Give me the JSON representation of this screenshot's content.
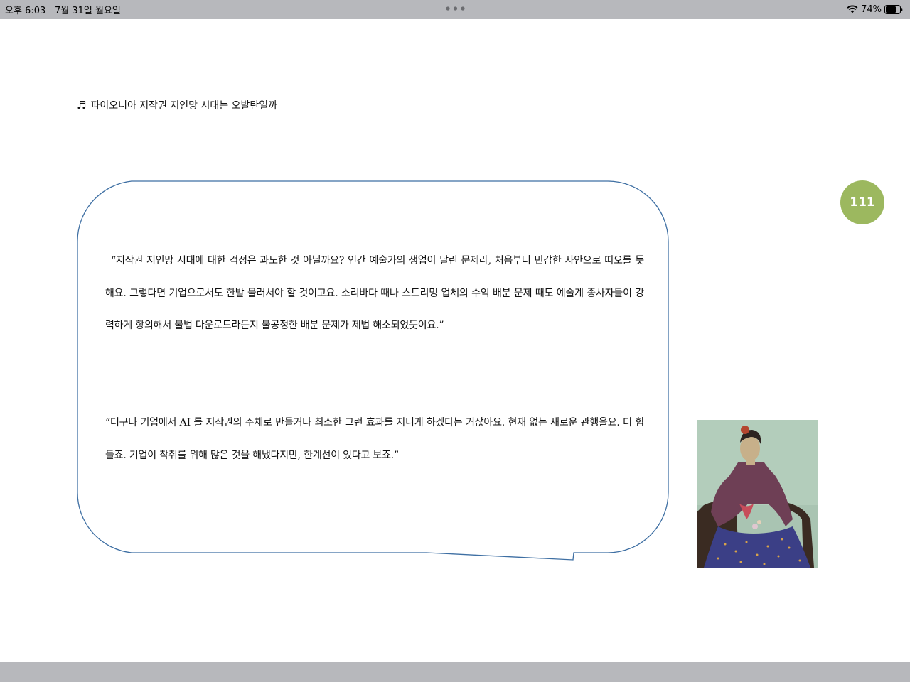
{
  "status_bar": {
    "time": "오후 6:03",
    "date": "7월 31일 월요일",
    "battery_percent": "74%",
    "battery_level": 0.74,
    "icons": [
      "wifi-icon",
      "battery-icon",
      "more-dots-icon"
    ]
  },
  "page": {
    "header": "파이오니아 저작권 저인망 시대는 오발탄일까",
    "header_icon": "music-note-icon",
    "page_number": "111",
    "badge_color": "#9cb85f",
    "bubble_color": "#3e6fa3",
    "quote1": "“저작권 저인망 시대에 대한 걱정은 과도한 것 아닐까요? 인간 예술가의 생업이 달린 문제라, 처음부터 민감한 사안으로 떠오를 듯해요. 그렇다면 기업으로서도 한발 물러서야 할 것이고요. 소리바다 때나 스트리밍 업체의 수익 배분 문제 때도 예술계 종사자들이 강력하게 항의해서 불법 다운로드라든지 불공정한 배분 문제가 제법 해소되었듯이요.”",
    "quote2": "“더구나 기업에서 AI 를 저작권의 주체로 만들거나 최소한 그런 효과를 지니게 하겠다는 거잖아요. 현재 없는 새로운 관행을요. 더 힘들죠. 기업이 착취를 위해 많은 것을 해냈다지만, 한계선이 있다고 보죠.”",
    "image": "portrait-painting"
  }
}
